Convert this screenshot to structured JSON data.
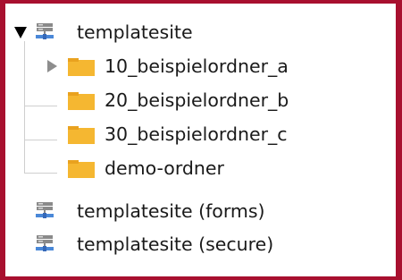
{
  "tree": {
    "root": {
      "label": "templatesite",
      "expanded": true,
      "icon": "server-icon",
      "children": [
        {
          "label": "10_beispielordner_a",
          "icon": "folder-icon",
          "has_children": true,
          "expanded": false
        },
        {
          "label": "20_beispielordner_b",
          "icon": "folder-icon",
          "has_children": false
        },
        {
          "label": "30_beispielordner_c",
          "icon": "folder-icon",
          "has_children": false
        },
        {
          "label": "demo-ordner",
          "icon": "folder-icon",
          "has_children": false
        }
      ]
    },
    "sites": [
      {
        "label": "templatesite (forms)",
        "icon": "server-icon"
      },
      {
        "label": "templatesite (secure)",
        "icon": "server-icon"
      }
    ]
  },
  "colors": {
    "frame_border": "#a8102f",
    "folder": "#f5b731",
    "folder_tab": "#e9a21f",
    "server_bar": "#8a8a8a",
    "server_blue": "#4a88d8"
  }
}
